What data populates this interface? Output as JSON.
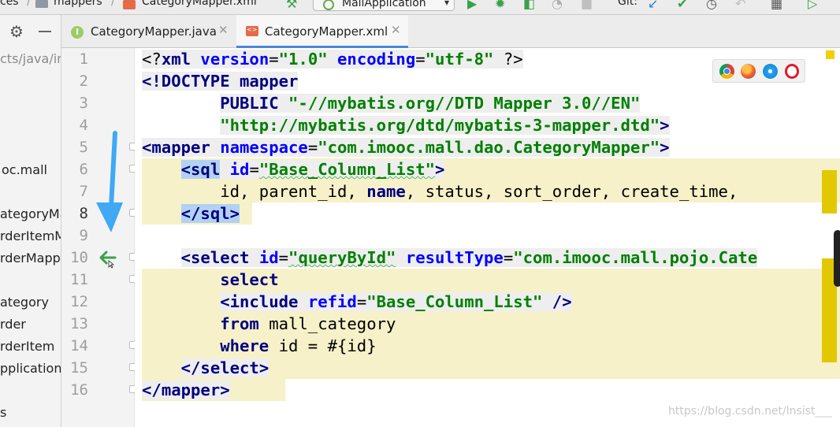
{
  "toolbar": {
    "breadcrumb_partial": "ces",
    "breadcrumb_folder": "mappers",
    "breadcrumb_file": "CategoryMapper.xml",
    "run_config": "MallApplication",
    "git_label": "Git:",
    "icons": [
      "hammer-icon",
      "run-icon",
      "debug-icon",
      "coverage-icon",
      "profile-icon",
      "stop-icon",
      "vcs-update-icon",
      "vcs-commit-icon",
      "history-icon",
      "revert-icon",
      "structure-icon",
      "preview-icon"
    ]
  },
  "project_panel": {
    "items": [
      {
        "label": "cts/java/in",
        "kind": "path"
      },
      {
        "label": "oc.mall",
        "kind": "package"
      },
      {
        "label": "ategoryMa",
        "kind": "file"
      },
      {
        "label": "rderItemM",
        "kind": "file"
      },
      {
        "label": "rderMappe",
        "kind": "file"
      },
      {
        "label": "ategory",
        "kind": "file"
      },
      {
        "label": "rder",
        "kind": "file"
      },
      {
        "label": "rderItem",
        "kind": "file"
      },
      {
        "label": "pplication",
        "kind": "file"
      },
      {
        "label": "s",
        "kind": "file"
      }
    ]
  },
  "tabs": [
    {
      "label": "CategoryMapper.java",
      "icon_letter": "I",
      "active": false
    },
    {
      "label": "CategoryMapper.xml",
      "active": true
    }
  ],
  "editor": {
    "line_numbers": [
      "1",
      "2",
      "3",
      "4",
      "5",
      "6",
      "7",
      "8",
      "9",
      "10",
      "11",
      "12",
      "13",
      "14",
      "15",
      "16"
    ],
    "current_line": "8"
  },
  "code": {
    "l1": {
      "p1": "<?",
      "p2": "xml",
      "p3": " ",
      "p4": "version",
      "p5": "=",
      "p6": "\"1.0\"",
      "p7": " ",
      "p8": "encoding",
      "p9": "=",
      "p10": "\"utf-8\"",
      "p11": " ?>"
    },
    "l2": {
      "p1": "<!DOCTYPE",
      "p2": " ",
      "p3": "mapper"
    },
    "l3": {
      "indent": "        ",
      "p1": "PUBLIC",
      "p2": " ",
      "p3": "\"-//mybatis.org//DTD Mapper 3.0//EN\""
    },
    "l4": {
      "indent": "        ",
      "p1": "\"http://mybatis.org/dtd/mybatis-3-mapper.dtd\"",
      "p2": ">"
    },
    "l5": {
      "p1": "<",
      "p2": "mapper",
      "p3": " ",
      "p4": "namespace",
      "p5": "=",
      "p6": "\"com.imooc.mall.dao.CategoryMapper\"",
      "p7": ">"
    },
    "l6": {
      "indent": "    ",
      "p1": "<",
      "p2": "sql",
      "p3": " ",
      "p4": "id",
      "p5": "=",
      "p6": "\"Base_Column_List\"",
      "p7": ">"
    },
    "l7": {
      "indent": "        ",
      "p1": "id, parent_id, ",
      "p2": "name",
      "p3": ", status, sort_order, create_time,"
    },
    "l8": {
      "indent": "    ",
      "p1": "</",
      "p2": "sql",
      "p3": ">"
    },
    "l10": {
      "indent": "    ",
      "p1": "<",
      "p2": "select",
      "p3": " ",
      "p4": "id",
      "p5": "=",
      "p6": "\"queryById\"",
      "p7": " ",
      "p8": "resultType",
      "p9": "=",
      "p10": "\"com.imooc.mall.pojo.Cate"
    },
    "l11": {
      "indent": "        ",
      "p1": "select"
    },
    "l12": {
      "indent": "        ",
      "p1": "<",
      "p2": "include",
      "p3": " ",
      "p4": "refid",
      "p5": "=",
      "p6": "\"Base_Column_List\"",
      "p7": " />"
    },
    "l13": {
      "indent": "        ",
      "p1": "from",
      "p2": " mall_category"
    },
    "l14": {
      "indent": "        ",
      "p1": "where",
      "p2": " id = #{id}"
    },
    "l15": {
      "indent": "    ",
      "p1": "</",
      "p2": "select",
      "p3": ">"
    },
    "l16": {
      "p1": "</",
      "p2": "mapper",
      "p3": ">"
    }
  },
  "browsers": [
    "chrome-icon",
    "firefox-icon",
    "safari-icon",
    "opera-icon"
  ],
  "watermark": "https://blog.csdn.net/lnsist___",
  "colors": {
    "tag": "#000080",
    "attribute": "#0000ff",
    "string": "#008000",
    "highlight": "#f6f1c9",
    "selection": "#b3d1f2",
    "annotation_arrow": "#3fa9f5",
    "gutter_arrow": "#3aa04a"
  }
}
